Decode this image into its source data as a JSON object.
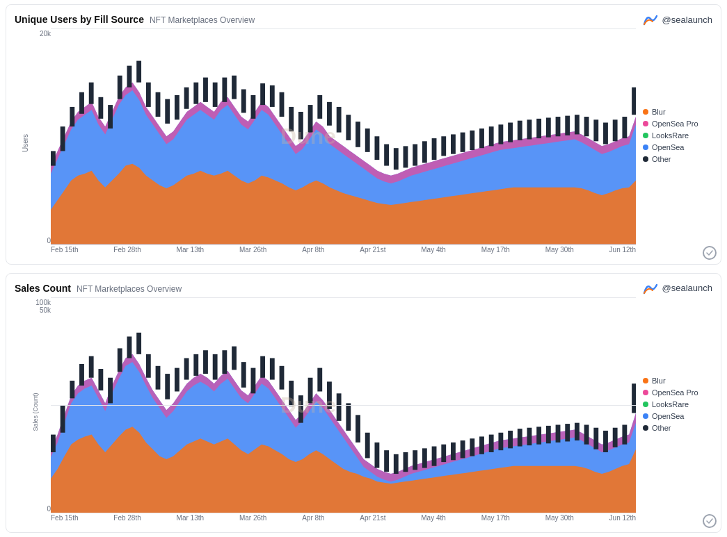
{
  "panels": [
    {
      "id": "unique-users",
      "title": "Unique Users by Fill Source",
      "subtitle": "NFT Marketplaces Overview",
      "brand": "@sealaunch",
      "y_axis_title": "Users",
      "y_ticks": [
        "20k",
        "0"
      ],
      "x_ticks": [
        "Feb 15th",
        "Feb 28th",
        "Mar 13th",
        "Mar 26th",
        "Apr 8th",
        "Apr 21st",
        "May 4th",
        "May 17th",
        "May 30th",
        "Jun 12th"
      ],
      "watermark": "Dune",
      "legend": [
        {
          "label": "Blur",
          "color": "#f97316"
        },
        {
          "label": "OpenSea Pro",
          "color": "#ec4899"
        },
        {
          "label": "LooksRare",
          "color": "#22c55e"
        },
        {
          "label": "OpenSea",
          "color": "#3b82f6"
        },
        {
          "label": "Other",
          "color": "#1f2937"
        }
      ]
    },
    {
      "id": "sales-count",
      "title": "Sales Count",
      "subtitle": "NFT Marketplaces Overview",
      "brand": "@sealaunch",
      "y_axis_title": "Sales (Count)",
      "y_ticks": [
        "100k",
        "50k",
        "0"
      ],
      "x_ticks": [
        "Feb 15th",
        "Feb 28th",
        "Mar 13th",
        "Mar 26th",
        "Apr 8th",
        "Apr 21st",
        "May 4th",
        "May 17th",
        "May 30th",
        "Jun 12th"
      ],
      "watermark": "Dune",
      "legend": [
        {
          "label": "Blur",
          "color": "#f97316"
        },
        {
          "label": "OpenSea Pro",
          "color": "#ec4899"
        },
        {
          "label": "LooksRare",
          "color": "#22c55e"
        },
        {
          "label": "OpenSea",
          "color": "#3b82f6"
        },
        {
          "label": "Other",
          "color": "#1f2937"
        }
      ]
    }
  ]
}
